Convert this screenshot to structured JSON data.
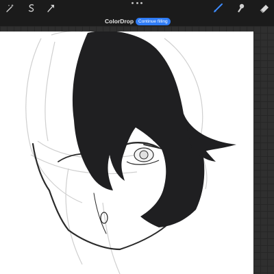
{
  "toolbar": {
    "left_tools": [
      "magic-wand-icon",
      "selection-icon",
      "transform-icon"
    ],
    "center": "more-icon",
    "right_tools": [
      "brush-icon",
      "smudge-icon",
      "eraser-icon"
    ],
    "accent_color": "#3d8bff"
  },
  "colordrop": {
    "label": "ColorDrop",
    "button_label": "Continue filling",
    "button_color": "#2f7cf6"
  },
  "canvas": {
    "background": "#ffffff",
    "fill_color": "#1f1f21"
  }
}
